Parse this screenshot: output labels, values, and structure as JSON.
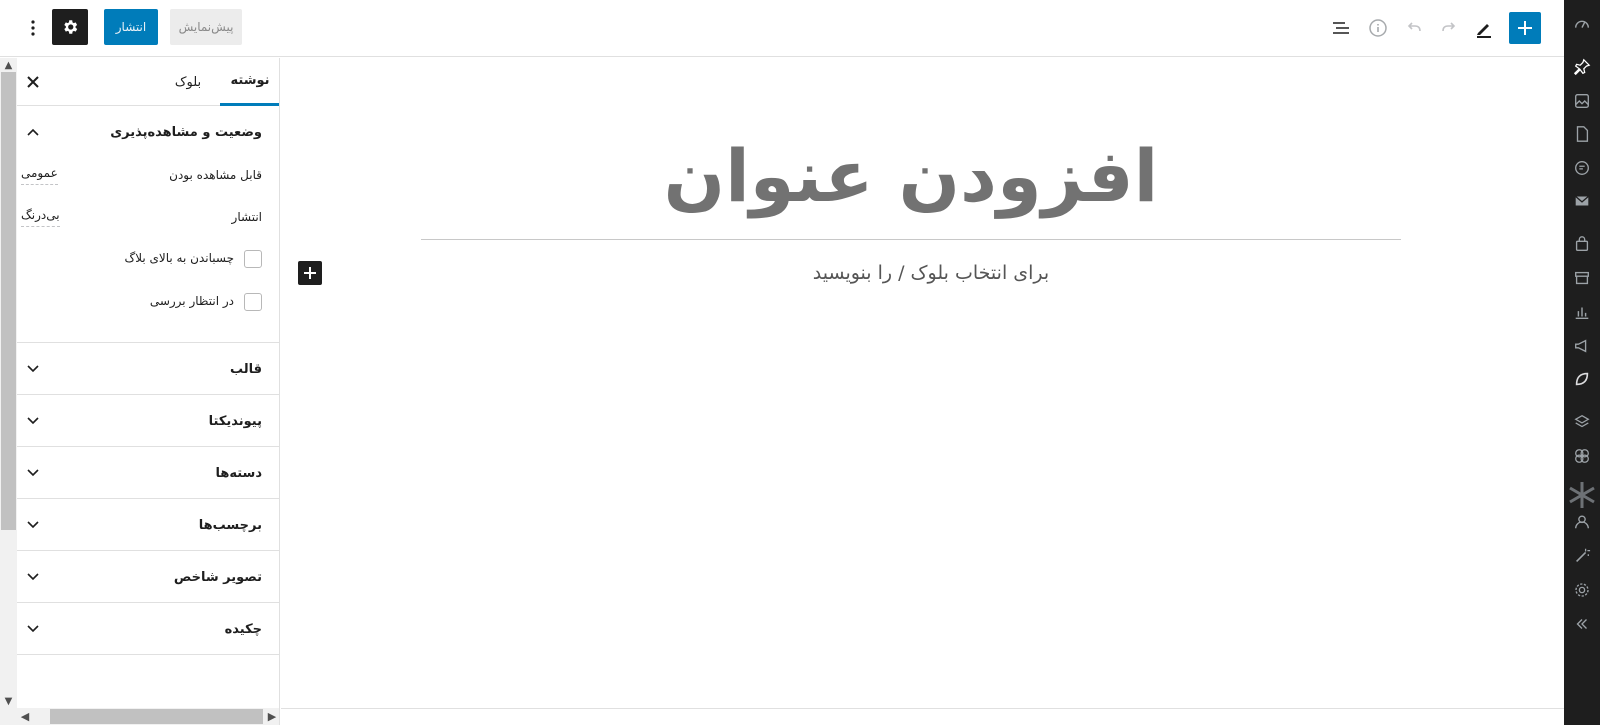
{
  "toolbar": {
    "publish_label": "انتشار",
    "preview_label": "پیش‌نمایش",
    "add_block_icon": "plus-icon",
    "edit_icon": "pencil-icon",
    "redo_icon": "redo-icon",
    "undo_icon": "undo-icon",
    "info_icon": "info-icon",
    "outline_icon": "list-view-icon",
    "settings_icon": "gear-icon",
    "more_icon": "vertical-ellipsis-icon"
  },
  "panel": {
    "tabs": [
      {
        "label": "نوشته",
        "active": true
      },
      {
        "label": "بلوک",
        "active": false
      }
    ],
    "status": {
      "title": "وضعیت و مشاهده‌پذیری",
      "visibility_label": "قابل مشاهده بودن",
      "visibility_value": "عمومی",
      "publish_label": "انتشار",
      "publish_value": "بی‌درنگ",
      "sticky_label": "چسباندن به بالای بلاگ",
      "pending_label": "در انتظار بررسی"
    },
    "sections": [
      {
        "title": "قالب"
      },
      {
        "title": "پیوندیکتا"
      },
      {
        "title": "دسته‌ها"
      },
      {
        "title": "برچسب‌ها"
      },
      {
        "title": "تصویر شاخص"
      },
      {
        "title": "چکیده"
      }
    ]
  },
  "editor": {
    "title": "افزودن عنوان",
    "placeholder": "برای انتخاب بلوک / را بنویسید"
  },
  "colors": {
    "accent": "#007cba",
    "admin_bg": "#1e1e1e",
    "admin_icon": "#9ca2a7"
  }
}
